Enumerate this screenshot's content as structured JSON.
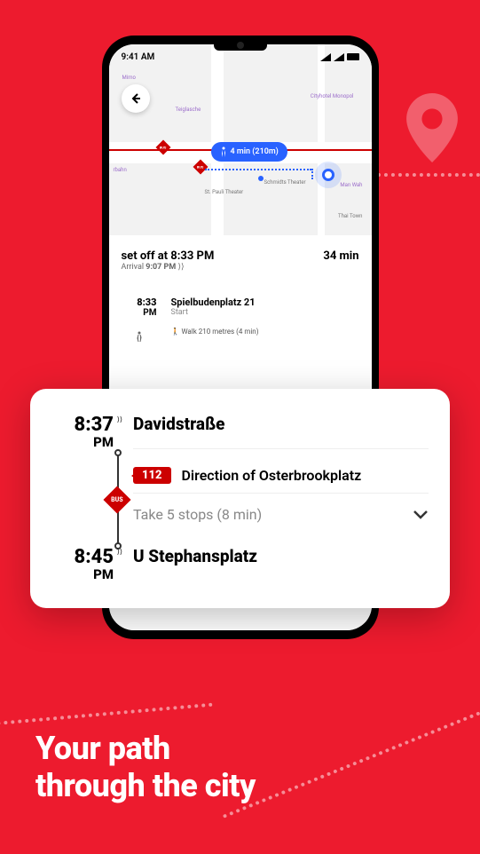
{
  "statusBar": {
    "time": "9:41 AM"
  },
  "map": {
    "walkPill": "4 min (210m)",
    "labels": {
      "mimo": "Mimo",
      "teiglasche": "Teiglasche",
      "rbahn": "rbahn",
      "cityhotel": "Cityhotel Monopol",
      "stpauli": "St. Pauli Theater",
      "schmidts": "Schmidts Theater",
      "manwah": "Man Wah",
      "thaitown": "Thai Town"
    }
  },
  "details": {
    "title": "set off at 8:33 PM",
    "duration": "34 min",
    "arrivalLabel": "Arrival",
    "arrivalTime": "9:07 PM",
    "step1": {
      "time": "8:33",
      "ampm": "PM",
      "name": "Spielbudenplatz 21",
      "label": "Start",
      "walk": "Walk 210 metres (4 min)"
    }
  },
  "overlay": {
    "stop1": {
      "time": "8:37",
      "ampm": "PM",
      "name": "Davidstraße"
    },
    "line": {
      "number": "112",
      "direction": "Direction of Osterbrookplatz"
    },
    "stops": "Take 5 stops (8 min)",
    "stop2": {
      "time": "8:45",
      "ampm": "PM",
      "name": "U Stephansplatz"
    },
    "busLabel": "BUS"
  },
  "tagline": {
    "line1": "Your path",
    "line2": "through the city"
  }
}
